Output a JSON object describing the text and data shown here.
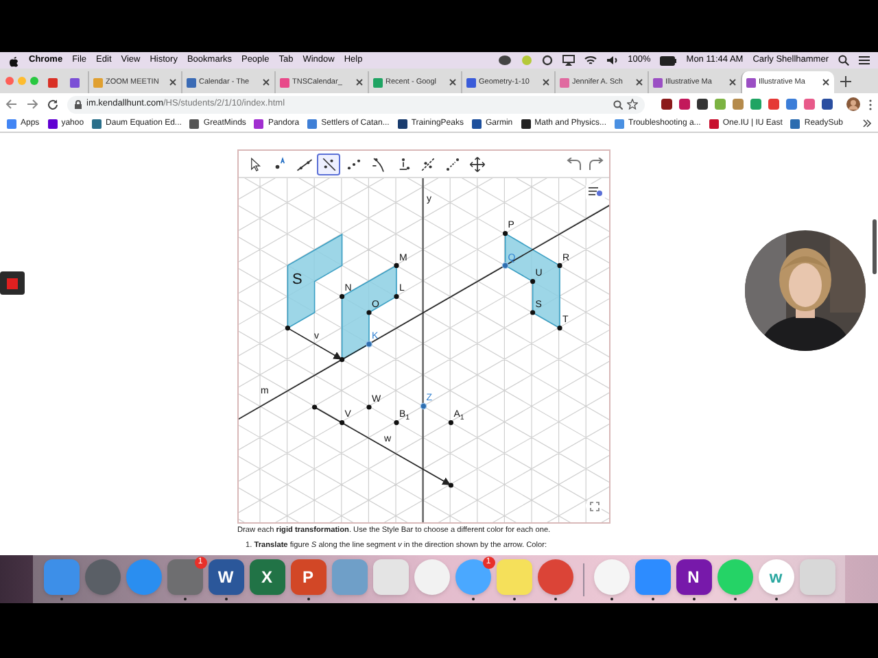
{
  "menu_bar": {
    "app": "Chrome",
    "items": [
      "File",
      "Edit",
      "View",
      "History",
      "Bookmarks",
      "People",
      "Tab",
      "Window",
      "Help"
    ],
    "battery": "100%",
    "clock": "Mon 11:44 AM",
    "user": "Carly Shellhammer"
  },
  "tabs": [
    {
      "color": "#d93025",
      "selected": false
    },
    {
      "color": "#7b4fd6",
      "selected": false
    },
    {
      "label": "ZOOM MEETIN",
      "color": "#e0a030",
      "selected": false
    },
    {
      "label": "Calendar - The",
      "color": "#3b6bb5",
      "selected": false
    },
    {
      "label": "TNSCalendar_",
      "color": "#e84a8a",
      "selected": false
    },
    {
      "label": "Recent - Googl",
      "color": "#1fa463",
      "selected": false
    },
    {
      "label": "Geometry-1-10",
      "color": "#3a5bd9",
      "selected": false
    },
    {
      "label": "Jennifer A. Sch",
      "color": "#e06aa0",
      "selected": false
    },
    {
      "label": "Illustrative Ma",
      "color": "#9b4fc4",
      "selected": false
    },
    {
      "label": "Illustrative Ma",
      "color": "#9b4fc4",
      "selected": true
    }
  ],
  "address_bar": {
    "host": "im.kendallhunt.com",
    "path": "/HS/students/2/1/10/index.html"
  },
  "bookmarks": [
    {
      "label": "Apps",
      "color": "#4285f4"
    },
    {
      "label": "yahoo",
      "color": "#6001d2"
    },
    {
      "label": "Daum Equation Ed...",
      "color": "#2a6f8a"
    },
    {
      "label": "GreatMinds",
      "color": "#555555"
    },
    {
      "label": "Pandora",
      "color": "#a12fd0"
    },
    {
      "label": "Settlers of Catan...",
      "color": "#3f7fd6"
    },
    {
      "label": "TrainingPeaks",
      "color": "#1a3c6e"
    },
    {
      "label": "Garmin",
      "color": "#1c4f9c"
    },
    {
      "label": "Math and Physics...",
      "color": "#222222"
    },
    {
      "label": "Troubleshooting a...",
      "color": "#4a90e2"
    },
    {
      "label": "One.IU | IU East",
      "color": "#c8102e"
    },
    {
      "label": "ReadySub",
      "color": "#2b6cb0"
    }
  ],
  "applet": {
    "tools": [
      {
        "selected": false
      },
      {
        "selected": false
      },
      {
        "selected": false
      },
      {
        "selected": true
      },
      {
        "selected": false
      },
      {
        "selected": false
      },
      {
        "selected": false
      },
      {
        "selected": false
      },
      {
        "selected": false
      },
      {
        "selected": false
      }
    ],
    "figure_label": "S",
    "points": [
      {
        "label": "N",
        "highlighted": false
      },
      {
        "label": "M",
        "highlighted": false
      },
      {
        "label": "L",
        "highlighted": false
      },
      {
        "label": "O",
        "highlighted": false
      },
      {
        "label": "K",
        "highlighted": true
      },
      {
        "label": "P",
        "highlighted": false
      },
      {
        "label": "Q",
        "highlighted": true
      },
      {
        "label": "R",
        "highlighted": false
      },
      {
        "label": "U",
        "highlighted": false
      },
      {
        "label": "S",
        "highlighted": false
      },
      {
        "label": "T",
        "highlighted": false
      },
      {
        "label": "W",
        "highlighted": false
      },
      {
        "label": "Z",
        "highlighted": true
      },
      {
        "label": "V",
        "highlighted": false
      },
      {
        "label": "B$_{1}$",
        "highlighted": false
      },
      {
        "label": "A$_{1}$",
        "highlighted": false
      }
    ],
    "line_labels": [
      "y",
      "v",
      "m",
      "w"
    ]
  },
  "instructions": [
    "Draw each **rigid transformation**. Use the Style Bar to choose a different color for each one.",
    "1. **Translate** figure *S* along the line segment *v* in the direction shown by the arrow. Color:"
  ],
  "dock": [
    {
      "kind": "square",
      "color": "#3d8fe8",
      "running": true
    },
    {
      "kind": "circle",
      "color": "#5a5f66",
      "running": false
    },
    {
      "kind": "circle",
      "color": "#2a8ef0",
      "running": false
    },
    {
      "kind": "square",
      "color": "#6e6e70",
      "badge": "1",
      "running": true
    },
    {
      "kind": "square",
      "color": "#2b579a",
      "glyph": "W",
      "running": true
    },
    {
      "kind": "square",
      "color": "#217346",
      "glyph": "X",
      "running": false
    },
    {
      "kind": "square",
      "color": "#d24726",
      "glyph": "P",
      "running": true
    },
    {
      "kind": "square",
      "color": "#6f9fc8",
      "running": false
    },
    {
      "kind": "square",
      "color": "#e4e4e4",
      "running": false
    },
    {
      "kind": "circle",
      "color": "#f2f2f2",
      "running": false
    },
    {
      "kind": "circle",
      "color": "#4aa8ff",
      "badge": "1",
      "running": true
    },
    {
      "kind": "square",
      "color": "#f5e05a",
      "running": true
    },
    {
      "kind": "circle",
      "color": "#db4437",
      "running": true
    },
    {
      "kind": "divider",
      "color": "#9a8a9a"
    },
    {
      "kind": "circle",
      "color": "#f5f5f5",
      "running": true
    },
    {
      "kind": "square",
      "color": "#2d8cff",
      "running": true
    },
    {
      "kind": "square",
      "color": "#7719aa",
      "glyph": "N",
      "running": true
    },
    {
      "kind": "circle",
      "color": "#25d366",
      "running": true
    },
    {
      "kind": "circle",
      "color": "#ffffff",
      "glyph": "w",
      "running": true
    },
    {
      "kind": "square",
      "color": "#d8d8d8",
      "running": false
    }
  ]
}
